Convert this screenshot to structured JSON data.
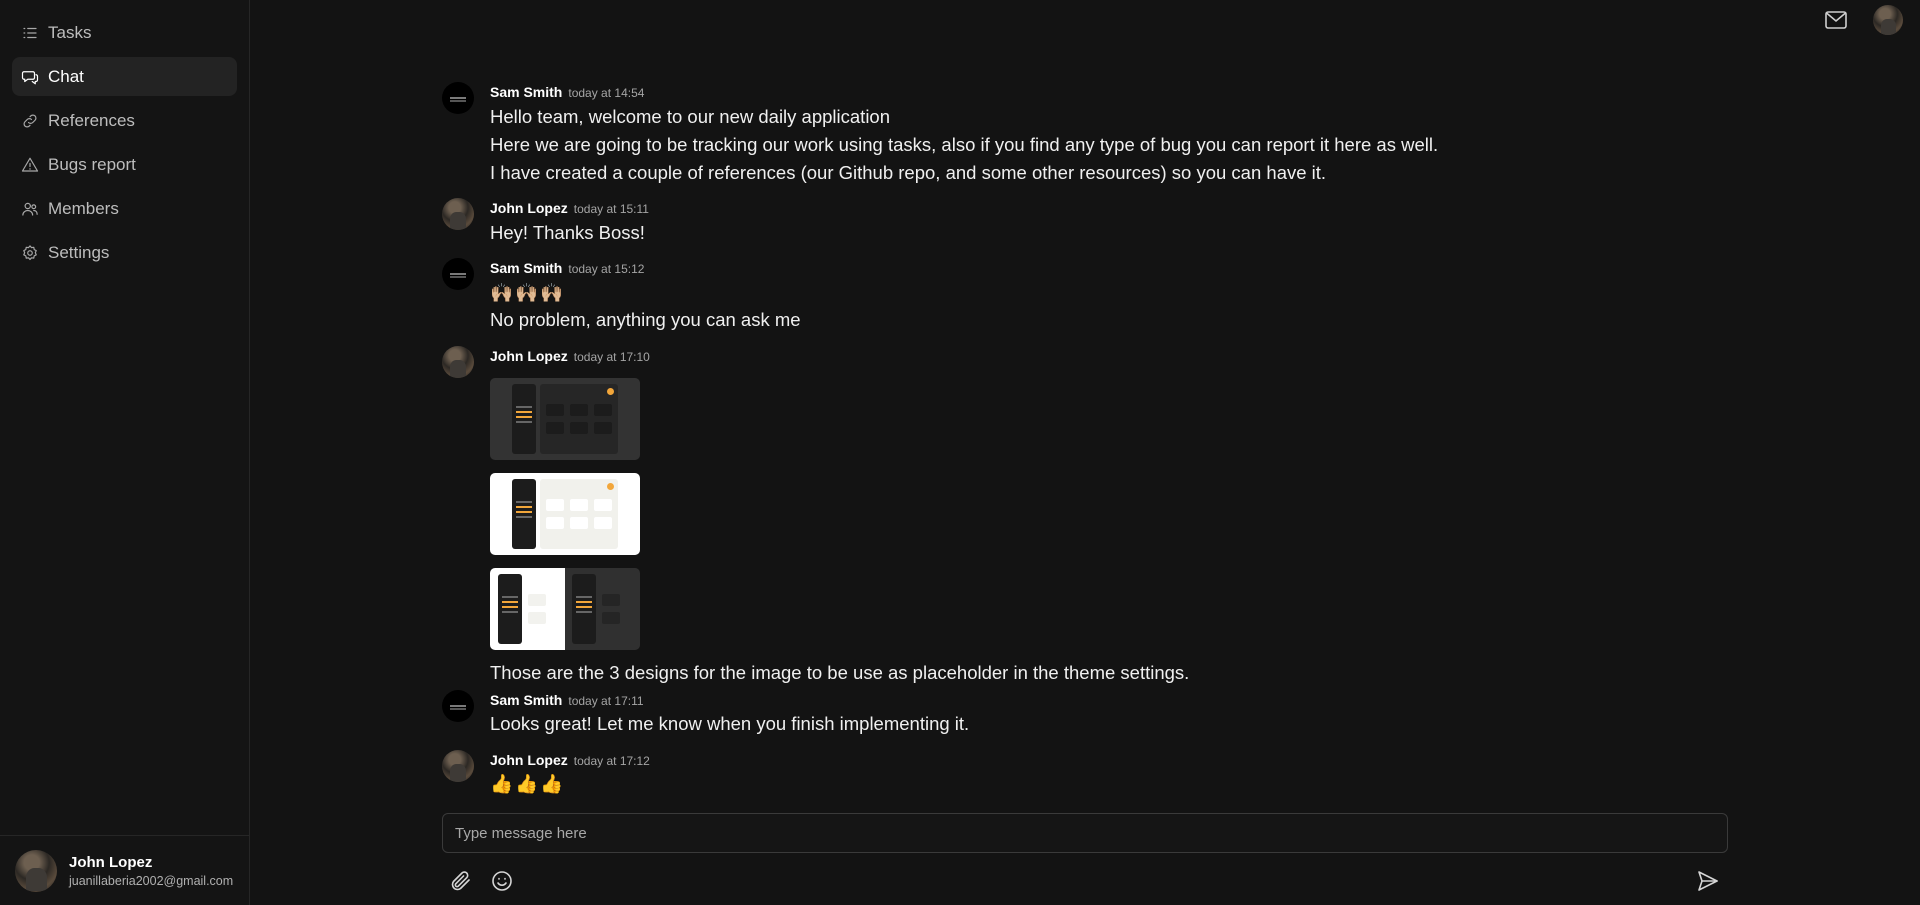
{
  "sidebar": {
    "items": [
      {
        "label": "Tasks",
        "icon": "list-icon"
      },
      {
        "label": "Chat",
        "icon": "chat-icon",
        "active": true
      },
      {
        "label": "References",
        "icon": "link-icon"
      },
      {
        "label": "Bugs report",
        "icon": "warning-icon"
      },
      {
        "label": "Members",
        "icon": "users-icon"
      },
      {
        "label": "Settings",
        "icon": "gear-icon"
      }
    ]
  },
  "user": {
    "name": "John Lopez",
    "email": "juanillaberia2002@gmail.com"
  },
  "messages": [
    {
      "author": "Sam Smith",
      "time": "today at 14:54",
      "lines": [
        "Hello team, welcome to our new daily application",
        "Here we are going to be tracking our work using tasks, also if you find any type of bug you can report it here as well.",
        "I have created a couple of references (our Github repo, and some other resources) so you can have it."
      ]
    },
    {
      "author": "John Lopez",
      "time": "today at 15:11",
      "lines": [
        "Hey! Thanks Boss!"
      ]
    },
    {
      "author": "Sam Smith",
      "time": "today at 15:12",
      "lines": [
        "🙌🏼🙌🏼🙌🏼",
        "No problem, anything you can ask me"
      ]
    },
    {
      "author": "John Lopez",
      "time": "today at 17:10",
      "lines": [
        "Those are the 3 designs for the image to be use as placeholder in the theme settings."
      ]
    },
    {
      "author": "Sam Smith",
      "time": "today at 17:11",
      "lines": [
        "Looks great! Let me know when you finish implementing it."
      ]
    },
    {
      "author": "John Lopez",
      "time": "today at 17:12",
      "lines": [
        "👍👍👍"
      ]
    }
  ],
  "composer": {
    "placeholder": "Type message here"
  },
  "colors": {
    "background": "#131313",
    "accent": "#f2a63a"
  }
}
